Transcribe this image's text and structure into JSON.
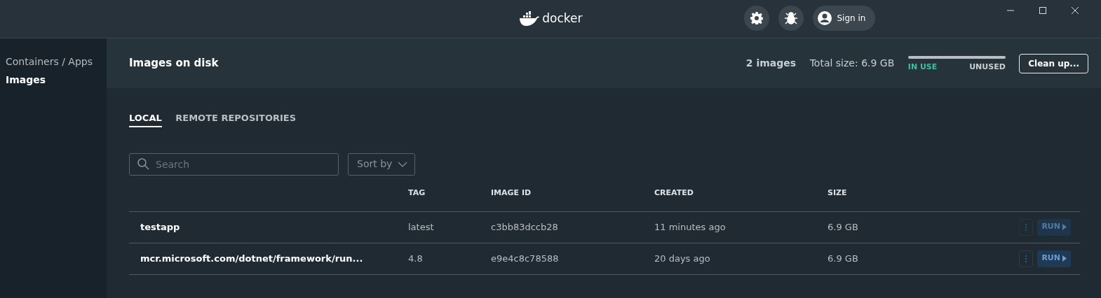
{
  "window": {
    "brand": "docker",
    "signin": "Sign in"
  },
  "sidebar": {
    "items": [
      {
        "label": "Containers / Apps",
        "selected": false
      },
      {
        "label": "Images",
        "selected": true
      }
    ]
  },
  "header": {
    "title": "Images on disk",
    "count": "2 images",
    "total": "Total size: 6.9 GB",
    "usage": {
      "in_use": "IN USE",
      "unused": "UNUSED"
    },
    "cleanup": "Clean up..."
  },
  "tabs": [
    {
      "label": "LOCAL",
      "selected": true
    },
    {
      "label": "REMOTE REPOSITORIES",
      "selected": false
    }
  ],
  "search": {
    "placeholder": "Search"
  },
  "sort": {
    "label": "Sort by"
  },
  "table": {
    "columns": [
      "TAG",
      "IMAGE ID",
      "CREATED",
      "SIZE"
    ],
    "rows": [
      {
        "name": "testapp",
        "tag": "latest",
        "image_id": "c3bb83dccb28",
        "created": "11 minutes ago",
        "size": "6.9 GB",
        "run": "RUN",
        "hovered": false
      },
      {
        "name": "mcr.microsoft.com/dotnet/framework/run...",
        "tag": "4.8",
        "image_id": "e9e4c8c78588",
        "created": "20 days ago",
        "size": "6.9 GB",
        "run": "RUN",
        "hovered": true
      }
    ]
  }
}
